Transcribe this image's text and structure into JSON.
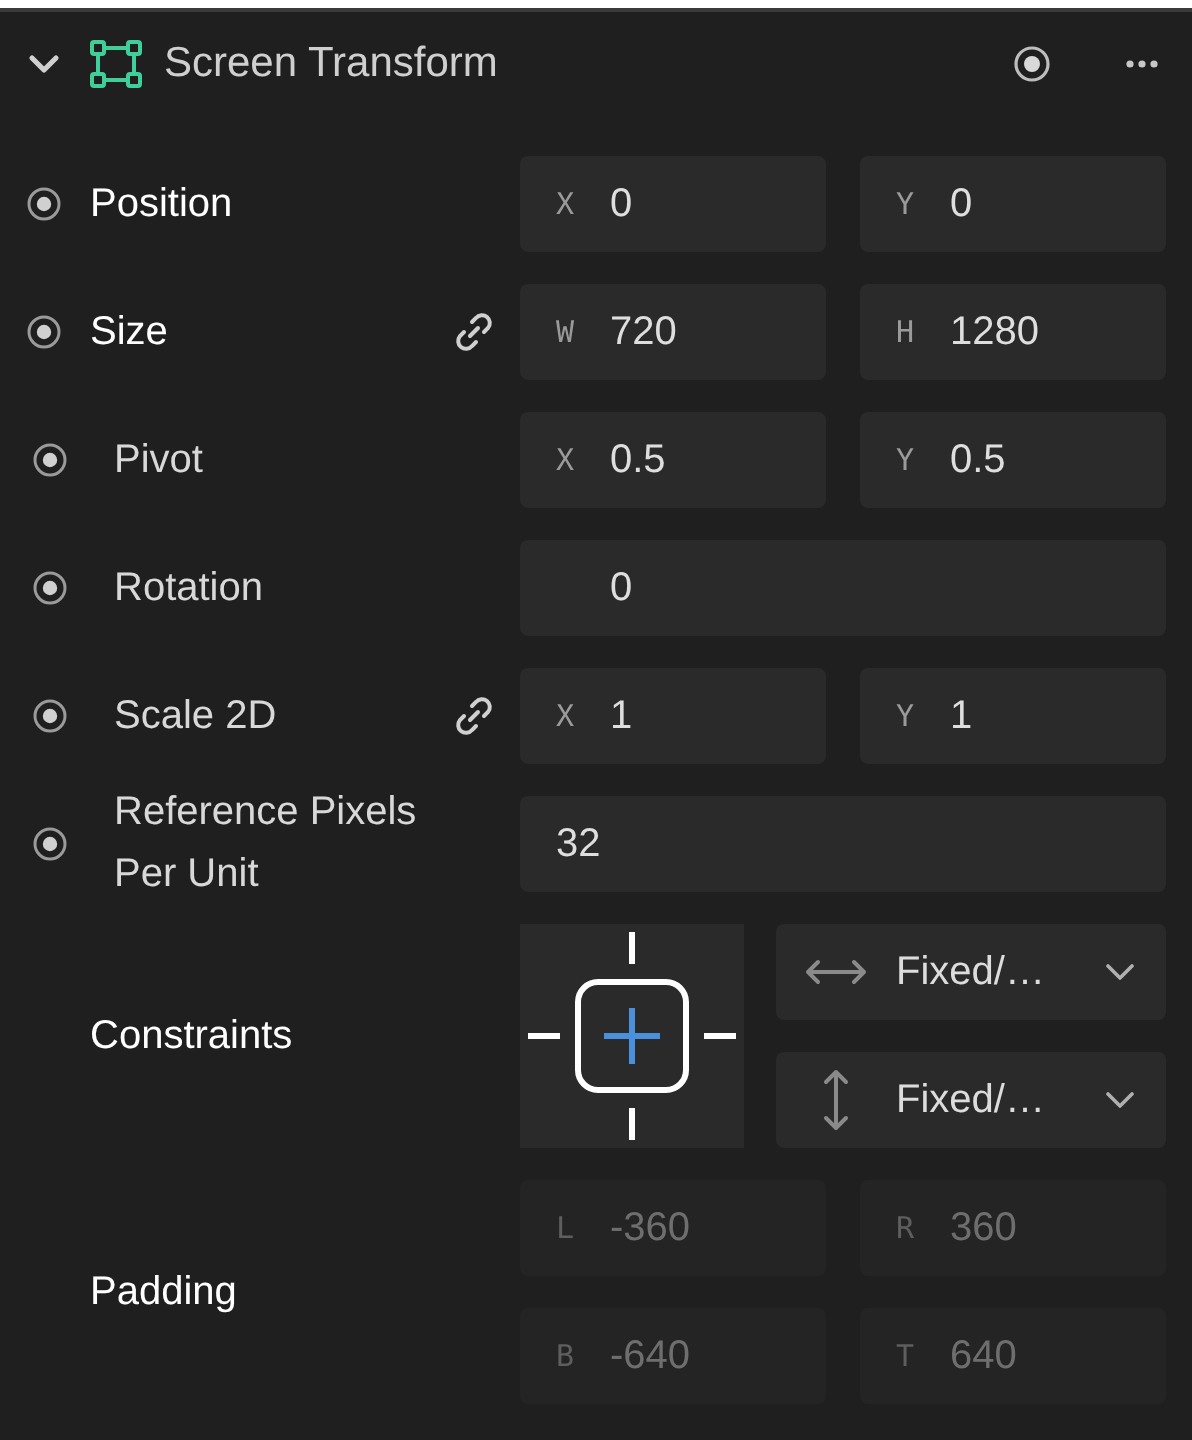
{
  "header": {
    "title": "Screen Transform",
    "expanded": true
  },
  "properties": [
    {
      "label": "Position",
      "kind": "pair",
      "emphasized": true,
      "dot": true,
      "linked": false,
      "disabled": false,
      "fields": [
        {
          "axis": "X",
          "value": "0"
        },
        {
          "axis": "Y",
          "value": "0"
        }
      ]
    },
    {
      "label": "Size",
      "kind": "pair",
      "emphasized": true,
      "dot": true,
      "linked": true,
      "disabled": false,
      "fields": [
        {
          "axis": "W",
          "value": "720"
        },
        {
          "axis": "H",
          "value": "1280"
        }
      ]
    },
    {
      "label": "Pivot",
      "kind": "pair",
      "emphasized": false,
      "dot": true,
      "linked": false,
      "disabled": false,
      "fields": [
        {
          "axis": "X",
          "value": "0.5"
        },
        {
          "axis": "Y",
          "value": "0.5"
        }
      ]
    },
    {
      "label": "Rotation",
      "kind": "single",
      "emphasized": false,
      "dot": true,
      "linked": false,
      "disabled": false,
      "fields": [
        {
          "inset": true,
          "value": "0"
        }
      ]
    },
    {
      "label": "Scale 2D",
      "kind": "pair",
      "emphasized": false,
      "dot": true,
      "linked": true,
      "disabled": false,
      "fields": [
        {
          "axis": "X",
          "value": "1"
        },
        {
          "axis": "Y",
          "value": "1"
        }
      ]
    },
    {
      "label": "Reference Pixels Per Unit",
      "kind": "single",
      "emphasized": false,
      "dot": true,
      "linked": false,
      "disabled": false,
      "fields": [
        {
          "inset": false,
          "value": "32"
        }
      ]
    },
    {
      "label": "Constraints",
      "kind": "constraints",
      "emphasized": true,
      "dot": false,
      "linked": false,
      "dropdowns": [
        {
          "kind": "horizontal",
          "value": "Fixed/…"
        },
        {
          "kind": "vertical",
          "value": "Fixed/…"
        }
      ]
    },
    {
      "label": "Padding",
      "kind": "grid",
      "emphasized": true,
      "dot": false,
      "linked": false,
      "disabled": true,
      "fields": [
        {
          "axis": "L",
          "value": "-360"
        },
        {
          "axis": "R",
          "value": "360"
        },
        {
          "axis": "B",
          "value": "-640"
        },
        {
          "axis": "T",
          "value": "640"
        }
      ]
    }
  ]
}
